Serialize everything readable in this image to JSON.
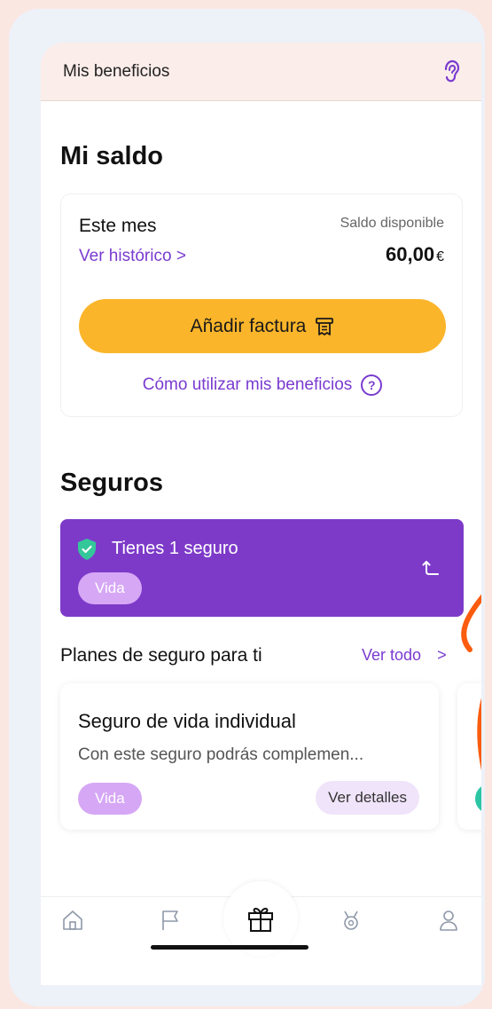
{
  "header": {
    "title": "Mis beneficios",
    "icon": "ear-icon"
  },
  "balance": {
    "section_title": "Mi saldo",
    "period": "Este mes",
    "history_link": "Ver histórico >",
    "available_label": "Saldo disponible",
    "amount": "60,00",
    "currency": "€",
    "add_invoice_button": "Añadir factura",
    "how_to_link": "Cómo utilizar mis beneficios",
    "help_icon": "?"
  },
  "insurance": {
    "section_title": "Seguros",
    "active_text": "Tienes 1 seguro",
    "tag": "Vida"
  },
  "plans": {
    "title": "Planes de seguro para ti",
    "see_all": "Ver todo",
    "see_all_chevron": ">",
    "items": [
      {
        "title": "Seguro de vida individual",
        "description": "Con este seguro podrás complemen...",
        "tag": "Vida",
        "details_button": "Ver detalles"
      }
    ]
  },
  "tabbar": {
    "items": [
      "home-icon",
      "flag-icon",
      "gift-icon",
      "trophy-icon",
      "user-icon"
    ],
    "active": "gift-icon"
  },
  "colors": {
    "accent_purple": "#7d3ac9",
    "link_purple": "#7a3bd0",
    "cta_yellow": "#fbb52a",
    "swipe_hint_orange": "#fb5c0e"
  }
}
